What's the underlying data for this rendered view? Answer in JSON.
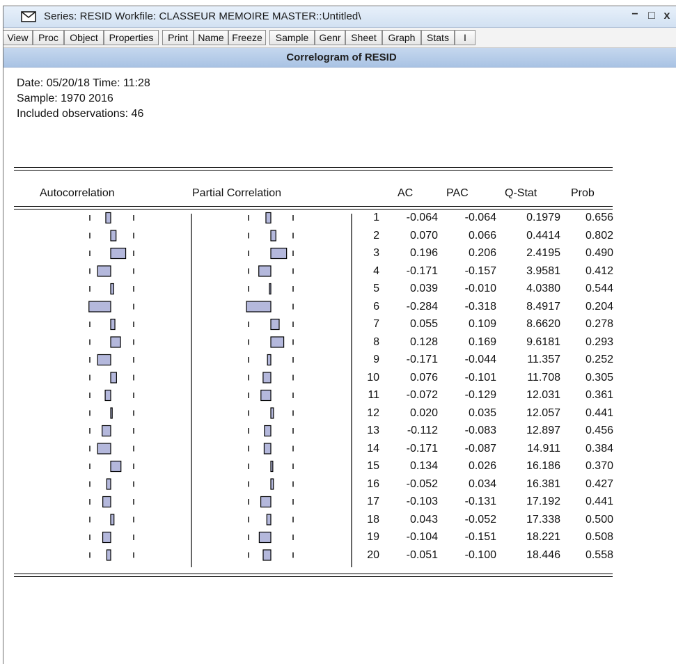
{
  "window": {
    "title": "Series: RESID   Workfile: CLASSEUR MEMOIRE MASTER::Untitled\\",
    "controls": {
      "minimize": "−",
      "maximize": "□",
      "close": "x"
    }
  },
  "toolbar": {
    "buttons": [
      "View",
      "Proc",
      "Object",
      "Properties",
      "Print",
      "Name",
      "Freeze",
      "Sample",
      "Genr",
      "Sheet",
      "Graph",
      "Stats",
      "I"
    ]
  },
  "view": {
    "title": "Correlogram of RESID",
    "date_line": "Date: 05/20/18   Time: 11:28",
    "sample_line": "Sample: 1970 2016",
    "obs_line": "Included observations: 46"
  },
  "table": {
    "headers": {
      "autocorrelation": "Autocorrelation",
      "partial": "Partial Correlation",
      "ac": "AC",
      "pac": "PAC",
      "qstat": "Q-Stat",
      "prob": "Prob"
    },
    "rows": [
      {
        "lag": "1",
        "ac": "-0.064",
        "pac": "-0.064",
        "q": "0.1979",
        "prob": "0.656"
      },
      {
        "lag": "2",
        "ac": "0.070",
        "pac": "0.066",
        "q": "0.4414",
        "prob": "0.802"
      },
      {
        "lag": "3",
        "ac": "0.196",
        "pac": "0.206",
        "q": "2.4195",
        "prob": "0.490"
      },
      {
        "lag": "4",
        "ac": "-0.171",
        "pac": "-0.157",
        "q": "3.9581",
        "prob": "0.412"
      },
      {
        "lag": "5",
        "ac": "0.039",
        "pac": "-0.010",
        "q": "4.0380",
        "prob": "0.544"
      },
      {
        "lag": "6",
        "ac": "-0.284",
        "pac": "-0.318",
        "q": "8.4917",
        "prob": "0.204"
      },
      {
        "lag": "7",
        "ac": "0.055",
        "pac": "0.109",
        "q": "8.6620",
        "prob": "0.278"
      },
      {
        "lag": "8",
        "ac": "0.128",
        "pac": "0.169",
        "q": "9.6181",
        "prob": "0.293"
      },
      {
        "lag": "9",
        "ac": "-0.171",
        "pac": "-0.044",
        "q": "11.357",
        "prob": "0.252"
      },
      {
        "lag": "10",
        "ac": "0.076",
        "pac": "-0.101",
        "q": "11.708",
        "prob": "0.305"
      },
      {
        "lag": "11",
        "ac": "-0.072",
        "pac": "-0.129",
        "q": "12.031",
        "prob": "0.361"
      },
      {
        "lag": "12",
        "ac": "0.020",
        "pac": "0.035",
        "q": "12.057",
        "prob": "0.441"
      },
      {
        "lag": "13",
        "ac": "-0.112",
        "pac": "-0.083",
        "q": "12.897",
        "prob": "0.456"
      },
      {
        "lag": "14",
        "ac": "-0.171",
        "pac": "-0.087",
        "q": "14.911",
        "prob": "0.384"
      },
      {
        "lag": "15",
        "ac": "0.134",
        "pac": "0.026",
        "q": "16.186",
        "prob": "0.370"
      },
      {
        "lag": "16",
        "ac": "-0.052",
        "pac": "0.034",
        "q": "16.381",
        "prob": "0.427"
      },
      {
        "lag": "17",
        "ac": "-0.103",
        "pac": "-0.131",
        "q": "17.192",
        "prob": "0.441"
      },
      {
        "lag": "18",
        "ac": "0.043",
        "pac": "-0.052",
        "q": "17.338",
        "prob": "0.500"
      },
      {
        "lag": "19",
        "ac": "-0.104",
        "pac": "-0.151",
        "q": "18.221",
        "prob": "0.508"
      },
      {
        "lag": "20",
        "ac": "-0.051",
        "pac": "-0.100",
        "q": "18.446",
        "prob": "0.558"
      }
    ]
  },
  "colors": {
    "bar_fill": "#b4b8dc",
    "bar_stroke": "#000000",
    "titlebar": "#dbe7f5",
    "header_band": "#b7cde9"
  },
  "icons": {
    "app": "series-envelope-icon"
  }
}
